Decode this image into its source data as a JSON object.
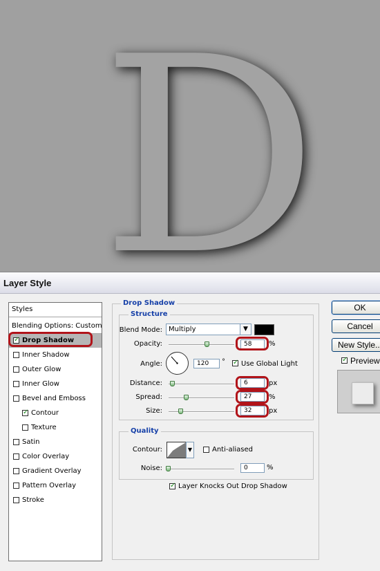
{
  "canvas": {
    "letter": "D"
  },
  "dialog": {
    "title": "Layer Style",
    "styles_panel": {
      "header": "Styles",
      "blending_options": "Blending Options: Custom",
      "items": [
        {
          "label": "Drop Shadow",
          "checked": true,
          "selected": true
        },
        {
          "label": "Inner Shadow",
          "checked": false
        },
        {
          "label": "Outer Glow",
          "checked": false
        },
        {
          "label": "Inner Glow",
          "checked": false
        },
        {
          "label": "Bevel and Emboss",
          "checked": false
        },
        {
          "label": "Contour",
          "checked": true
        },
        {
          "label": "Texture",
          "checked": false
        },
        {
          "label": "Satin",
          "checked": false
        },
        {
          "label": "Color Overlay",
          "checked": false
        },
        {
          "label": "Gradient Overlay",
          "checked": false
        },
        {
          "label": "Pattern Overlay",
          "checked": false
        },
        {
          "label": "Stroke",
          "checked": false
        }
      ]
    },
    "drop_shadow": {
      "section_title": "Drop Shadow",
      "structure": {
        "title": "Structure",
        "blend_mode_label": "Blend Mode:",
        "blend_mode_value": "Multiply",
        "shadow_color": "#000000",
        "opacity_label": "Opacity:",
        "opacity_value": "58",
        "opacity_unit": "%",
        "angle_label": "Angle:",
        "angle_value": "120",
        "angle_unit": "°",
        "use_global_light_label": "Use Global Light",
        "use_global_light": true,
        "distance_label": "Distance:",
        "distance_value": "6",
        "distance_unit": "px",
        "spread_label": "Spread:",
        "spread_value": "27",
        "spread_unit": "%",
        "size_label": "Size:",
        "size_value": "32",
        "size_unit": "px"
      },
      "quality": {
        "title": "Quality",
        "contour_label": "Contour:",
        "anti_aliased_label": "Anti-aliased",
        "anti_aliased": false,
        "noise_label": "Noise:",
        "noise_value": "0",
        "noise_unit": "%"
      },
      "knockout_label": "Layer Knocks Out Drop Shadow",
      "knockout": true
    },
    "buttons": {
      "ok": "OK",
      "cancel": "Cancel",
      "new_style": "New Style...",
      "preview_label": "Preview",
      "preview": true
    },
    "colors": {
      "highlight_ring": "#b1141a",
      "group_title": "#1640a8"
    }
  }
}
